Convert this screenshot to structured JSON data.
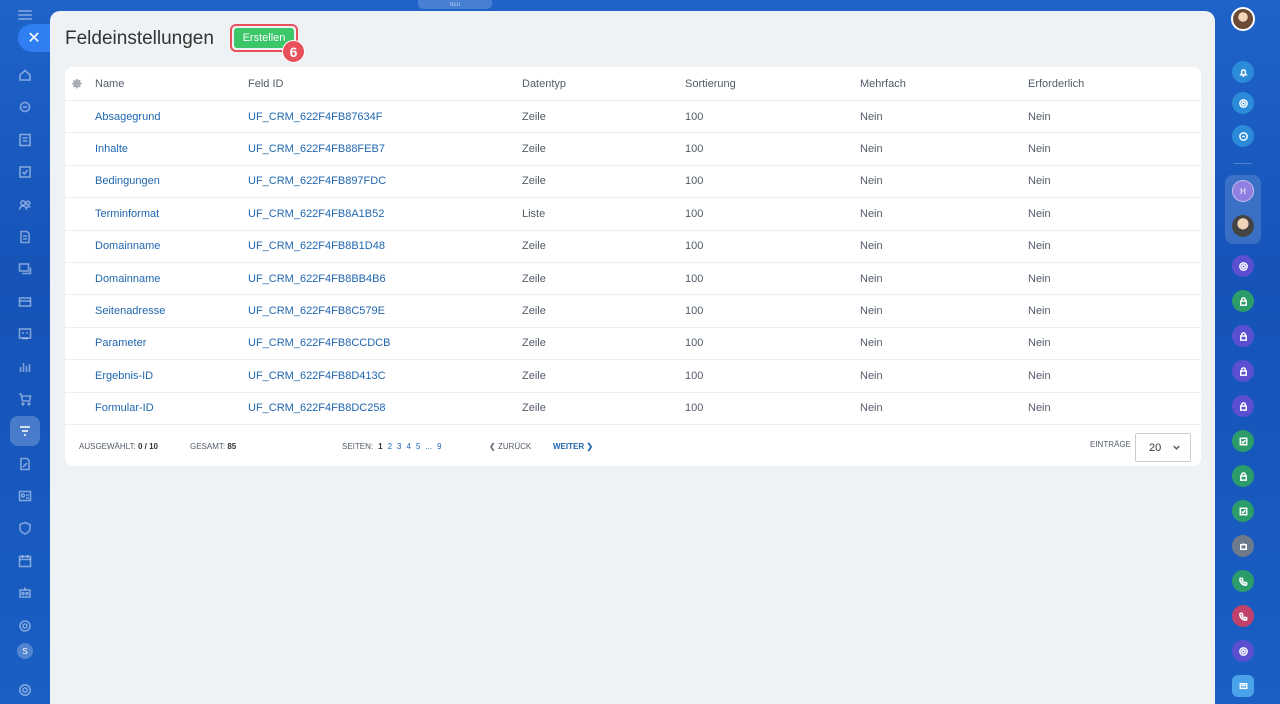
{
  "top_tab": {
    "label": "NEU"
  },
  "page": {
    "title": "Feldeinstellungen",
    "create_label": "Erstellen",
    "step_badge": "6"
  },
  "table": {
    "columns": [
      "Name",
      "Feld ID",
      "Datentyp",
      "Sortierung",
      "Mehrfach",
      "Erforderlich"
    ],
    "rows": [
      [
        "Absagegrund",
        "UF_CRM_622F4FB87634F",
        "Zeile",
        "100",
        "Nein",
        "Nein"
      ],
      [
        "Inhalte",
        "UF_CRM_622F4FB88FEB7",
        "Zeile",
        "100",
        "Nein",
        "Nein"
      ],
      [
        "Bedingungen",
        "UF_CRM_622F4FB897FDC",
        "Zeile",
        "100",
        "Nein",
        "Nein"
      ],
      [
        "Terminformat",
        "UF_CRM_622F4FB8A1B52",
        "Liste",
        "100",
        "Nein",
        "Nein"
      ],
      [
        "Domainname",
        "UF_CRM_622F4FB8B1D48",
        "Zeile",
        "100",
        "Nein",
        "Nein"
      ],
      [
        "Domainname",
        "UF_CRM_622F4FB8BB4B6",
        "Zeile",
        "100",
        "Nein",
        "Nein"
      ],
      [
        "Seitenadresse",
        "UF_CRM_622F4FB8C579E",
        "Zeile",
        "100",
        "Nein",
        "Nein"
      ],
      [
        "Parameter",
        "UF_CRM_622F4FB8CCDCB",
        "Zeile",
        "100",
        "Nein",
        "Nein"
      ],
      [
        "Ergebnis-ID",
        "UF_CRM_622F4FB8D413C",
        "Zeile",
        "100",
        "Nein",
        "Nein"
      ],
      [
        "Formular-ID",
        "UF_CRM_622F4FB8DC258",
        "Zeile",
        "100",
        "Nein",
        "Nein"
      ]
    ]
  },
  "footer": {
    "selected_label": "AUSGEWÄHLT:",
    "selected_value": "0 / 10",
    "total_label": "GESAMT:",
    "total_value": "85",
    "pages_label": "SEITEN:",
    "pages": [
      "1",
      "2",
      "3",
      "4",
      "5",
      "...",
      "9"
    ],
    "current_page": "1",
    "prev_label": "ZURÜCK",
    "next_label": "WEITER",
    "entries_label": "EINTRÄGE",
    "entries_value": "20"
  },
  "left_sidebar": {
    "icons": [
      "home-icon",
      "feed-icon",
      "tasks-icon",
      "checkbox-icon",
      "contacts-icon",
      "documents-icon",
      "chat-icon",
      "card-icon",
      "terminal-icon",
      "analytics-icon",
      "cart-icon",
      "filter-icon",
      "sign-icon",
      "id-card-icon",
      "shield-icon",
      "calendar-icon",
      "robot-icon",
      "target-icon"
    ],
    "user_initial": "S"
  },
  "right_sidebar": {
    "group_initial": "H",
    "colors": {
      "bell": "#2c8bd8",
      "purple": "#5a4fd1",
      "green": "#2c9c6a",
      "red": "#c0426a",
      "lightblue": "#4aa2e8"
    }
  }
}
